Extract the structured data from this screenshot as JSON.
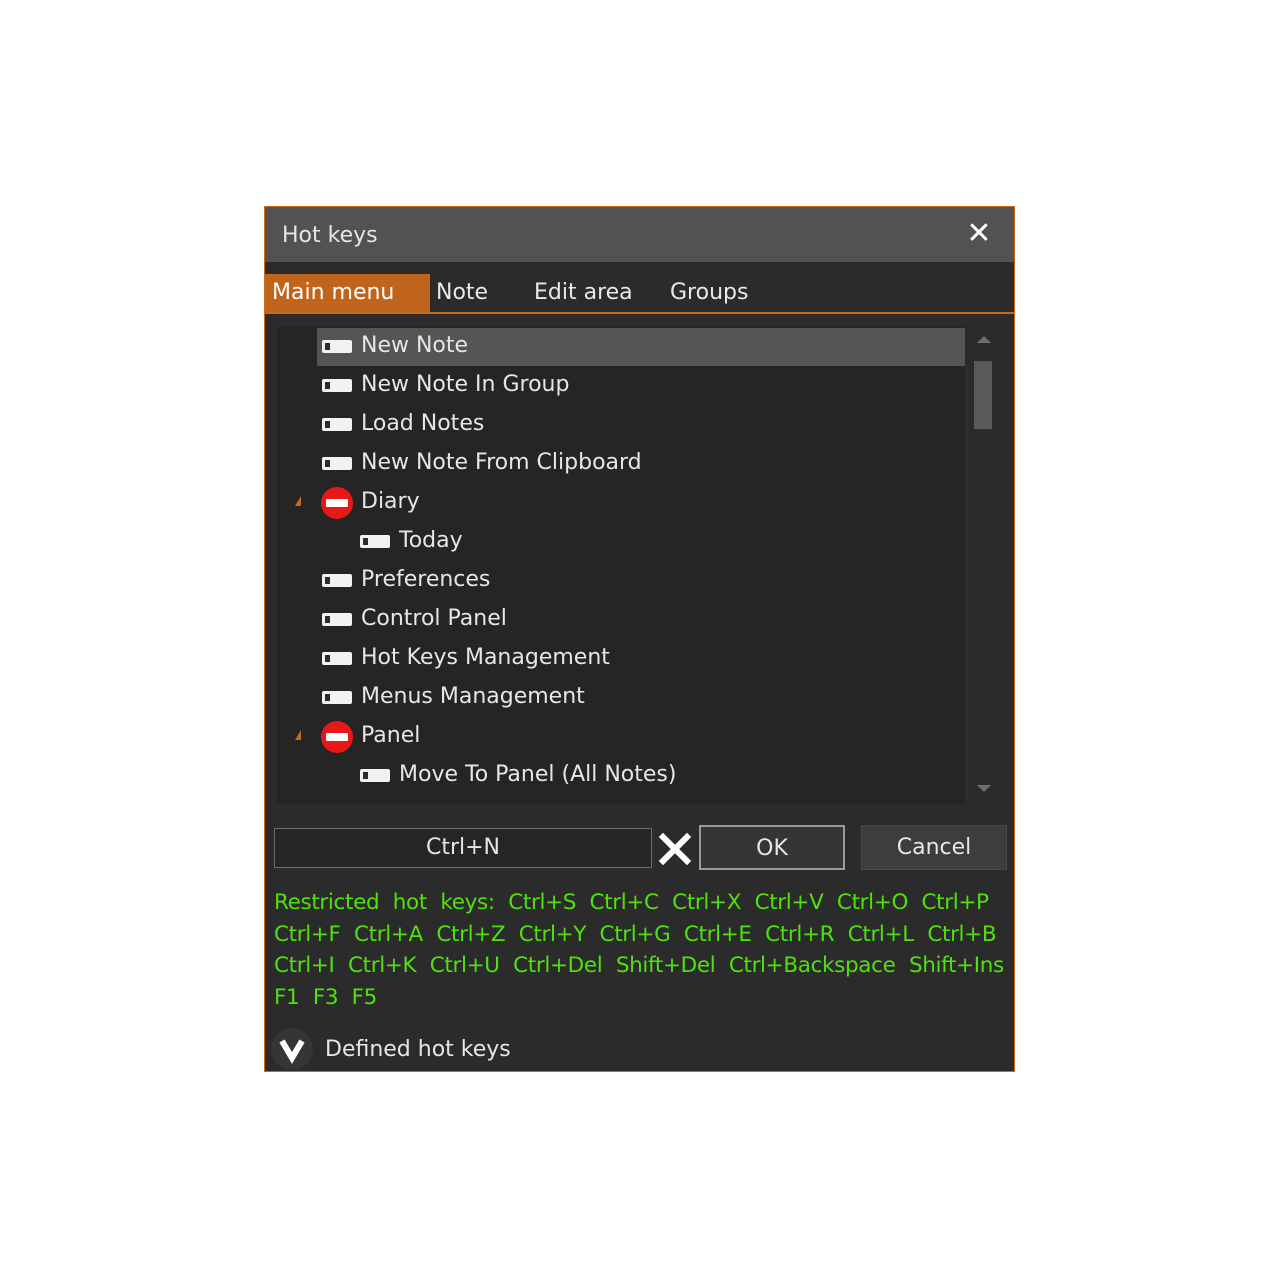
{
  "window": {
    "title": "Hot keys",
    "close_glyph": "✕"
  },
  "tabs": [
    {
      "label": "Main menu",
      "active": true
    },
    {
      "label": "Note",
      "active": false
    },
    {
      "label": "Edit area",
      "active": false
    },
    {
      "label": "Groups",
      "active": false
    }
  ],
  "tree": {
    "items": [
      {
        "label": "New Note",
        "icon": "key-icon",
        "selected": true
      },
      {
        "label": "New Note In Group",
        "icon": "key-icon"
      },
      {
        "label": "Load Notes",
        "icon": "key-icon"
      },
      {
        "label": "New Note From Clipboard",
        "icon": "key-icon"
      },
      {
        "label": "Diary",
        "icon": "restricted-icon",
        "expanded": true
      },
      {
        "label": "Today",
        "icon": "key-icon",
        "child": true
      },
      {
        "label": "Preferences",
        "icon": "key-icon"
      },
      {
        "label": "Control Panel",
        "icon": "key-icon"
      },
      {
        "label": "Hot Keys Management",
        "icon": "key-icon"
      },
      {
        "label": "Menus Management",
        "icon": "key-icon"
      },
      {
        "label": "Panel",
        "icon": "restricted-icon",
        "expanded": true
      },
      {
        "label": "Move To Panel (All Notes)",
        "icon": "key-icon",
        "child": true
      }
    ]
  },
  "hotkey": {
    "value": "Ctrl+N"
  },
  "buttons": {
    "ok": "OK",
    "cancel": "Cancel",
    "clear_icon": "clear-x-icon"
  },
  "restricted": {
    "text": "Restricted hot keys: Ctrl+S Ctrl+C Ctrl+X Ctrl+V Ctrl+O Ctrl+P Ctrl+F Ctrl+A Ctrl+Z Ctrl+Y Ctrl+G Ctrl+E Ctrl+R Ctrl+L Ctrl+B Ctrl+I Ctrl+K Ctrl+U Ctrl+Del Shift+Del Ctrl+Backspace Shift+Ins F1 F3 F5",
    "color": "#4fe00f"
  },
  "defined": {
    "label": "Defined hot keys",
    "icon": "chevron-down-icon"
  },
  "colors": {
    "accent": "#c86a1e",
    "tab_active": "#c0641c",
    "background": "#2b2b2b",
    "titlebar": "#525252"
  }
}
